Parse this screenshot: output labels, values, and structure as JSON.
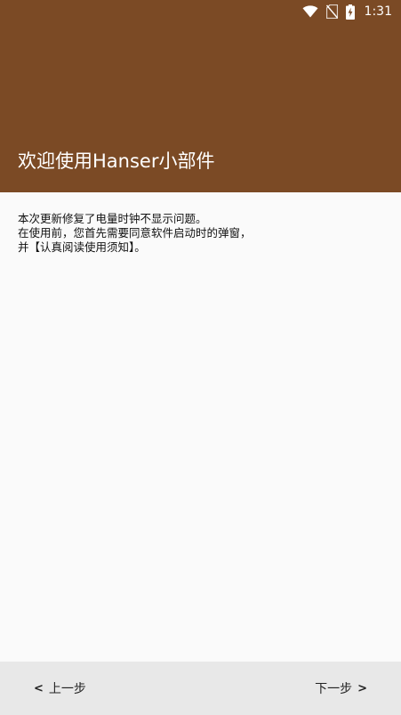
{
  "status_bar": {
    "time": "1:31",
    "icons": [
      "wifi-icon",
      "no-sim-icon",
      "battery-charging-icon"
    ]
  },
  "header": {
    "title": "欢迎使用Hanser小部件",
    "background_color": "#7b4a25"
  },
  "content": {
    "lines": [
      "本次更新修复了电量时钟不显示问题。",
      "在使用前，您首先需要同意软件启动时的弹窗，",
      "并【认真阅读使用须知】。"
    ]
  },
  "footer": {
    "prev_label": "上一步",
    "prev_chevron": "<",
    "next_label": "下一步",
    "next_chevron": ">"
  }
}
